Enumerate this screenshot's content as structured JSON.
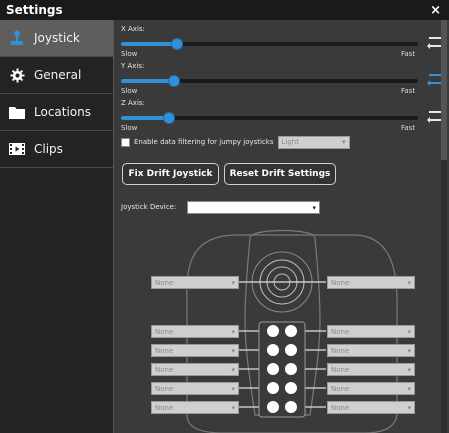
{
  "window": {
    "title": "Settings",
    "close_glyph": "×"
  },
  "sidebar": {
    "items": [
      {
        "label": "Joystick",
        "icon": "joystick-icon",
        "active": true
      },
      {
        "label": "General",
        "icon": "gear-icon",
        "active": false
      },
      {
        "label": "Locations",
        "icon": "folder-icon",
        "active": false
      },
      {
        "label": "Clips",
        "icon": "clip-icon",
        "active": false
      }
    ]
  },
  "axes": [
    {
      "label": "X Axis:",
      "slow": "Slow",
      "fast": "Fast",
      "value": 0.19,
      "swap_active": false
    },
    {
      "label": "Y Axis:",
      "slow": "Slow",
      "fast": "Fast",
      "value": 0.18,
      "swap_active": true
    },
    {
      "label": "Z Axis:",
      "slow": "Slow",
      "fast": "Fast",
      "value": 0.16,
      "swap_active": false
    }
  ],
  "filter": {
    "checkbox_label": "Enable data filtering for jumpy joysticks",
    "checked": false,
    "level": "Light"
  },
  "buttons": {
    "fix_drift": "Fix Drift Joystick",
    "reset_drift": "Reset Drift Settings"
  },
  "device": {
    "label": "Joystick Device:",
    "value": ""
  },
  "mapping": {
    "stick_left": "None",
    "stick_right": "None",
    "left_buttons": [
      "None",
      "None",
      "None",
      "None",
      "None"
    ],
    "right_buttons": [
      "None",
      "None",
      "None",
      "None",
      "None"
    ]
  },
  "colors": {
    "accent": "#2f92d8",
    "sidebar_active": "#5e5e5e",
    "titlebar": "#1a1a1a"
  }
}
